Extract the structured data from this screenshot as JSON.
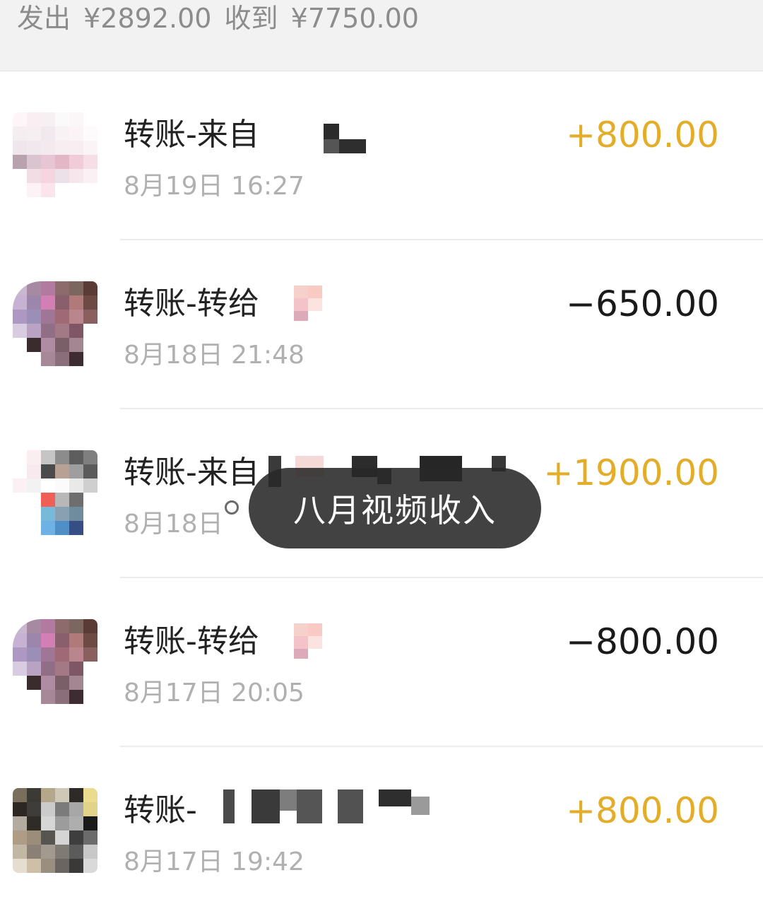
{
  "summary": {
    "sent_label": "发出",
    "sent_value": "¥2892.00",
    "received_label": "收到",
    "received_value": "¥7750.00"
  },
  "transactions": [
    {
      "title": "转账-来自",
      "time": "8月19日 16:27",
      "amount": "+800.00",
      "kind": "income"
    },
    {
      "title": "转账-转给",
      "time": "8月18日 21:48",
      "amount": "−650.00",
      "kind": "expense"
    },
    {
      "title": "转账-来自",
      "time": "8月18日",
      "amount": "+1900.00",
      "kind": "income"
    },
    {
      "title": "转账-转给",
      "time": "8月17日 20:05",
      "amount": "−800.00",
      "kind": "expense"
    },
    {
      "title": "转账-",
      "time": "8月17日 19:42",
      "amount": "+800.00",
      "kind": "income"
    }
  ],
  "toast": {
    "text": "八月视频收入"
  },
  "colors": {
    "income": "#e3ad2a",
    "expense": "#1a1a1a",
    "muted": "#b0b0b0",
    "toast_bg": "#282828"
  }
}
